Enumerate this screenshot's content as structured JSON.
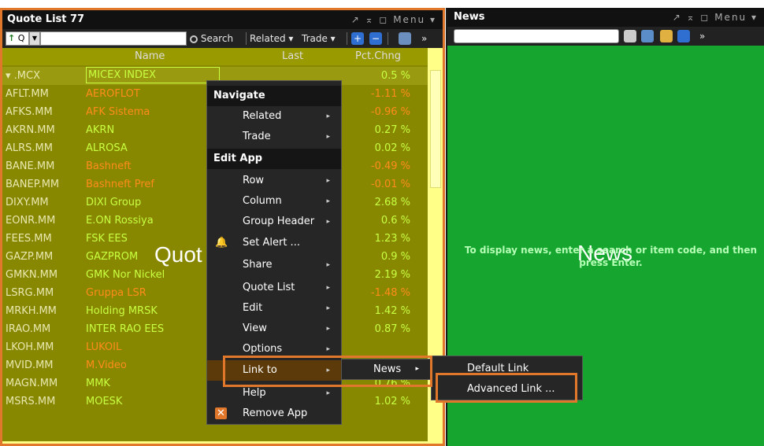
{
  "quote_list": {
    "title": "Quote List 77",
    "window_controls": "↗ ⌅ ◻ Menu ▾",
    "toolbar": {
      "symbol_value": "Q",
      "search_label": "Search",
      "related_label": "Related ▾",
      "trade_label": "Trade ▾",
      "more_label": "»"
    },
    "columns": {
      "name": "Name",
      "last": "Last",
      "pct_change": "Pct.Chng"
    },
    "watermark": "Quot",
    "rows": [
      {
        "symbol": "▾ .MCX",
        "name": "MICEX INDEX",
        "pct": "0.5 %",
        "name_color": "#c8ff40",
        "pct_color": "#c8ff40"
      },
      {
        "symbol": "AFLT.MM",
        "name": "AEROFLOT",
        "pct": "-1.11 %",
        "name_color": "#ff8c1a",
        "pct_color": "#ff8c1a"
      },
      {
        "symbol": "AFKS.MM",
        "name": "AFK Sistema",
        "pct": "-0.96 %",
        "name_color": "#ff8c1a",
        "pct_color": "#ff8c1a"
      },
      {
        "symbol": "AKRN.MM",
        "name": "AKRN",
        "pct": "0.27 %",
        "name_color": "#c8ff40",
        "pct_color": "#c8ff40"
      },
      {
        "symbol": "ALRS.MM",
        "name": "ALROSA",
        "pct": "0.02 %",
        "name_color": "#c8ff40",
        "pct_color": "#c8ff40"
      },
      {
        "symbol": "BANE.MM",
        "name": "Bashneft",
        "pct": "-0.49 %",
        "name_color": "#ff8c1a",
        "pct_color": "#ff8c1a"
      },
      {
        "symbol": "BANEP.MM",
        "name": "Bashneft Pref",
        "pct": "-0.01 %",
        "name_color": "#ff8c1a",
        "pct_color": "#ff8c1a"
      },
      {
        "symbol": "DIXY.MM",
        "name": "DIXI Group",
        "pct": "2.68 %",
        "name_color": "#c8ff40",
        "pct_color": "#c8ff40"
      },
      {
        "symbol": "EONR.MM",
        "name": "E.ON Rossiya",
        "pct": "0.6 %",
        "name_color": "#c8ff40",
        "pct_color": "#c8ff40"
      },
      {
        "symbol": "FEES.MM",
        "name": "FSK EES",
        "pct": "1.23 %",
        "name_color": "#c8ff40",
        "pct_color": "#c8ff40"
      },
      {
        "symbol": "GAZP.MM",
        "name": "GAZPROM",
        "pct": "0.9 %",
        "name_color": "#c8ff40",
        "pct_color": "#c8ff40"
      },
      {
        "symbol": "GMKN.MM",
        "name": "GMK Nor Nickel",
        "pct": "2.19 %",
        "name_color": "#c8ff40",
        "pct_color": "#c8ff40"
      },
      {
        "symbol": "LSRG.MM",
        "name": "Gruppa LSR",
        "pct": "-1.48 %",
        "name_color": "#ff8c1a",
        "pct_color": "#ff8c1a"
      },
      {
        "symbol": "MRKH.MM",
        "name": "Holding MRSK",
        "pct": "1.42 %",
        "name_color": "#c8ff40",
        "pct_color": "#c8ff40"
      },
      {
        "symbol": "IRAO.MM",
        "name": "INTER RAO EES",
        "pct": "0.87 %",
        "name_color": "#c8ff40",
        "pct_color": "#c8ff40"
      },
      {
        "symbol": "LKOH.MM",
        "name": "LUKOIL",
        "pct": "",
        "name_color": "#ff8c1a",
        "pct_color": "#ff8c1a"
      },
      {
        "symbol": "MVID.MM",
        "name": "M.Video",
        "pct": "",
        "name_color": "#ff8c1a",
        "pct_color": "#ff8c1a"
      },
      {
        "symbol": "MAGN.MM",
        "name": "MMK",
        "pct": "0.76 %",
        "name_color": "#c8ff40",
        "pct_color": "#c8ff40"
      },
      {
        "symbol": "MSRS.MM",
        "name": "MOESK",
        "pct": "1.02 %",
        "name_color": "#c8ff40",
        "pct_color": "#c8ff40"
      }
    ]
  },
  "news": {
    "title": "News",
    "window_controls": "↗ ⌅ ◻ Menu ▾",
    "message": "To display news, enter a search or item code, and then press Enter.",
    "watermark": "News",
    "more_label": "»"
  },
  "context_menu": {
    "navigate_header": "Navigate",
    "related": "Related",
    "trade": "Trade",
    "edit_app_header": "Edit App",
    "row": "Row",
    "column": "Column",
    "group_header": "Group Header",
    "set_alert": "Set Alert ...",
    "share": "Share",
    "quote_list": "Quote List",
    "edit": "Edit",
    "view": "View",
    "options": "Options",
    "link_to": "Link to",
    "help": "Help",
    "remove_app": "Remove App",
    "arrow": "▸"
  },
  "link_submenu": {
    "news": "News"
  },
  "news_submenu": {
    "default_link": "Default Link",
    "advanced_link": "Advanced Link ..."
  },
  "colors": {
    "highlight_border": "#e0772a",
    "news_background": "#16a52f",
    "grid_background": "#888800"
  }
}
